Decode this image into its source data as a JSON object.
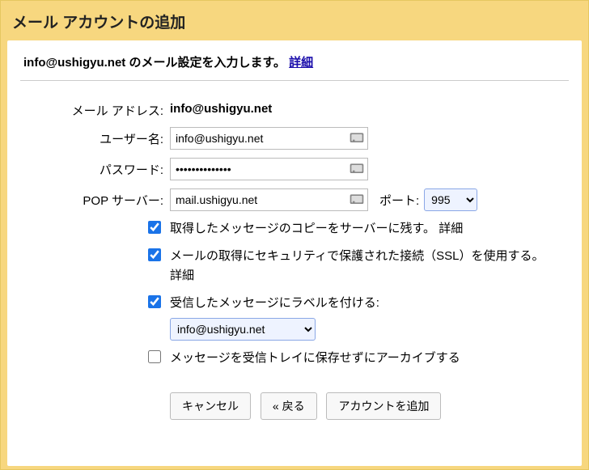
{
  "title": "メール アカウントの追加",
  "subtitle_prefix": "info@ushigyu.net のメール設定を入力します。",
  "details_link": "詳細",
  "labels": {
    "email": "メール アドレス:",
    "username": "ユーザー名:",
    "password": "パスワード:",
    "pop_server": "POP サーバー:",
    "port": "ポート:"
  },
  "values": {
    "email": "info@ushigyu.net",
    "username": "info@ushigyu.net",
    "password": "••••••••••••••",
    "pop_server": "mail.ushigyu.net",
    "port": "995"
  },
  "checkboxes": {
    "leave_copy": {
      "checked": true,
      "label": "取得したメッセージのコピーをサーバーに残す。",
      "link": "詳細"
    },
    "ssl": {
      "checked": true,
      "label": "メールの取得にセキュリティで保護された接続（SSL）を使用する。",
      "link": "詳細"
    },
    "label_msg": {
      "checked": true,
      "label": "受信したメッセージにラベルを付ける:",
      "select_value": "info@ushigyu.net"
    },
    "archive": {
      "checked": false,
      "label": "メッセージを受信トレイに保存せずにアーカイブする"
    }
  },
  "buttons": {
    "cancel": "キャンセル",
    "back": "« 戻る",
    "add": "アカウントを追加"
  }
}
